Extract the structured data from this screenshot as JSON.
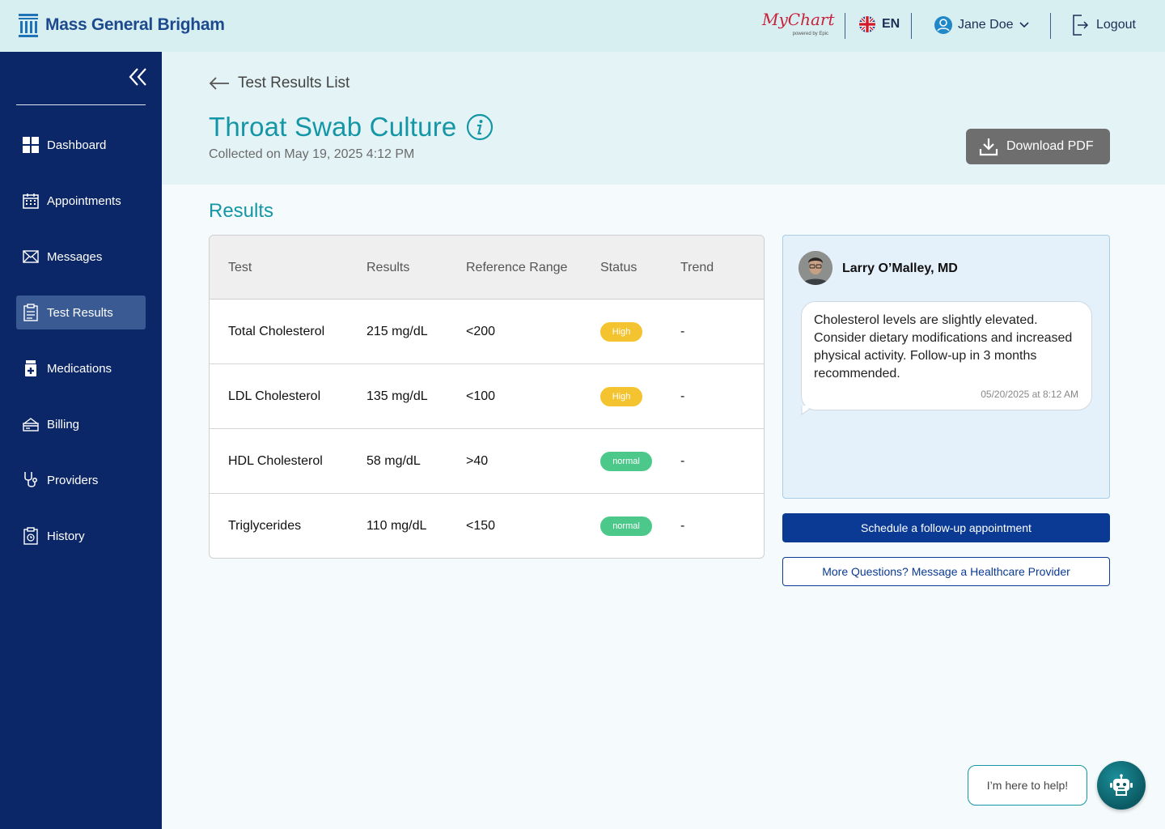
{
  "brand": {
    "name": "Mass General Brigham"
  },
  "topbar": {
    "mychart_logo": "MyChart",
    "mychart_powered": "powered by Epic",
    "language": "EN",
    "user_name": "Jane Doe",
    "logout_label": "Logout"
  },
  "sidebar": {
    "items": [
      {
        "label": "Dashboard",
        "icon": "grid-icon",
        "active": false
      },
      {
        "label": "Appointments",
        "icon": "calendar-icon",
        "active": false
      },
      {
        "label": "Messages",
        "icon": "envelope-icon",
        "active": false
      },
      {
        "label": "Test Results",
        "icon": "clipboard-icon",
        "active": true
      },
      {
        "label": "Medications",
        "icon": "pill-bottle-icon",
        "active": false
      },
      {
        "label": "Billing",
        "icon": "billing-icon",
        "active": false
      },
      {
        "label": "Providers",
        "icon": "stethoscope-icon",
        "active": false
      },
      {
        "label": "History",
        "icon": "clipboard-history-icon",
        "active": false
      }
    ]
  },
  "header": {
    "back_label": "Test Results List",
    "title": "Throat Swab Culture",
    "collected": "Collected on May 19, 2025 4:12 PM",
    "download_label": "Download PDF"
  },
  "results": {
    "heading": "Results",
    "columns": [
      "Test",
      "Results",
      "Reference Range",
      "Status",
      "Trend"
    ],
    "rows": [
      {
        "test": "Total Cholesterol",
        "result": "215 mg/dL",
        "range": "<200",
        "status": "High",
        "trend": "-"
      },
      {
        "test": "LDL Cholesterol",
        "result": "135 mg/dL",
        "range": "<100",
        "status": "High",
        "trend": "-"
      },
      {
        "test": "HDL Cholesterol",
        "result": "58 mg/dL",
        "range": ">40",
        "status": "normal",
        "trend": "-"
      },
      {
        "test": "Triglycerides",
        "result": "110 mg/dL",
        "range": "<150",
        "status": "normal",
        "trend": "-"
      }
    ]
  },
  "provider": {
    "name": "Larry O’Malley, MD",
    "message": "Cholesterol levels are slightly elevated. Consider dietary modifications and increased physical activity. Follow-up in 3 months recommended.",
    "timestamp": "05/20/2025 at 8:12 AM"
  },
  "actions": {
    "schedule_label": "Schedule a follow-up appointment",
    "message_label": "More Questions? Message a Healthcare Provider"
  },
  "assistant": {
    "prompt": "I’m here to help!"
  },
  "colors": {
    "sidebar": "#0c2767",
    "accent_teal": "#1496a6",
    "primary_blue": "#0a3a94",
    "status_high": "#f4c430",
    "status_normal": "#4cc98a"
  }
}
